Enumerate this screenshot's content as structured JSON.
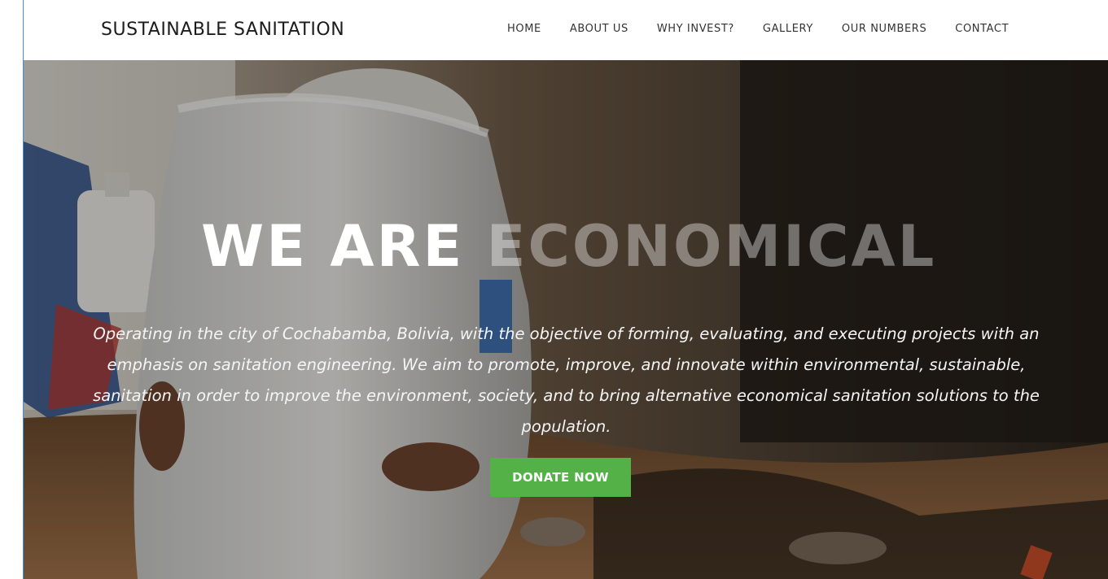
{
  "site": {
    "brand": "SUSTAINABLE SANITATION"
  },
  "nav": {
    "items": [
      {
        "label": "HOME"
      },
      {
        "label": "ABOUT US"
      },
      {
        "label": "WHY INVEST?"
      },
      {
        "label": "GALLERY"
      },
      {
        "label": "OUR NUMBERS"
      },
      {
        "label": "CONTACT"
      }
    ]
  },
  "hero": {
    "headline_lead": "WE ARE",
    "headline_word": "ECONOMICAL",
    "description": "Operating in the city of Cochabamba, Bolivia, with the objective of forming, evaluating, and executing projects with an emphasis on sanitation engineering. We aim to promote, improve, and innovate within environmental, sustainable, sanitation in order to improve the environment, society, and to bring alternative economical sanitation solutions to the population.",
    "cta_label": "DONATE NOW"
  },
  "colors": {
    "accent": "#54b148",
    "nav_text": "#333333",
    "frame_border": "#4a90c8"
  }
}
